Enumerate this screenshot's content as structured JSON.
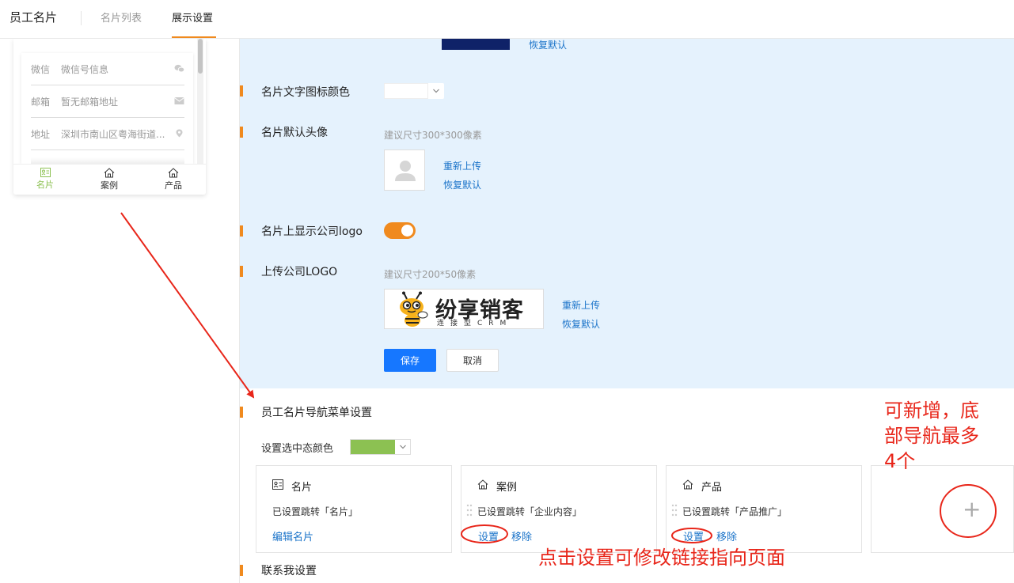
{
  "header": {
    "title": "员工名片",
    "tabs": [
      {
        "label": "名片列表",
        "active": false
      },
      {
        "label": "展示设置",
        "active": true
      }
    ]
  },
  "preview": {
    "rows": [
      {
        "key": "微信",
        "value": "微信号信息",
        "icon": "wechat-icon"
      },
      {
        "key": "邮箱",
        "value": "暂无邮箱地址",
        "icon": "mail-icon"
      },
      {
        "key": "地址",
        "value": "深圳市南山区粤海街道...",
        "icon": "location-pin-icon"
      }
    ],
    "bottom_nav": [
      {
        "label": "名片",
        "icon": "card-icon",
        "active": true
      },
      {
        "label": "案例",
        "icon": "home-icon",
        "active": false
      },
      {
        "label": "产品",
        "icon": "home-icon",
        "active": false
      }
    ]
  },
  "settings": {
    "top_reset": "恢复默认",
    "text_icon_color_label": "名片文字图标颜色",
    "default_avatar": {
      "label": "名片默认头像",
      "hint": "建议尺寸300*300像素",
      "reupload": "重新上传",
      "reset": "恢复默认"
    },
    "show_logo": {
      "label": "名片上显示公司logo",
      "on": true
    },
    "upload_logo": {
      "label": "上传公司LOGO",
      "hint": "建议尺寸200*50像素",
      "logo_text": "纷享销客",
      "logo_sub": "连接型CRM",
      "reupload": "重新上传",
      "reset": "恢复默认"
    },
    "save": "保存",
    "cancel": "取消"
  },
  "nav_menu": {
    "section_title": "员工名片导航菜单设置",
    "selected_color_label": "设置选中态颜色",
    "selected_color": "#8cc152",
    "accent": "#f08a1e",
    "cards": [
      {
        "title": "名片",
        "icon": "card-icon",
        "desc": "已设置跳转「名片」",
        "actions": [
          "编辑名片"
        ]
      },
      {
        "title": "案例",
        "icon": "home-icon",
        "desc": "已设置跳转「企业内容」",
        "actions": [
          "设置",
          "移除"
        ]
      },
      {
        "title": "产品",
        "icon": "home-icon",
        "desc": "已设置跳转「产品推广」",
        "actions": [
          "设置",
          "移除"
        ]
      }
    ],
    "add_symbol": "+"
  },
  "contact_section": {
    "title": "联系我设置"
  },
  "annotations": {
    "add_note_lines": [
      "可新增，底",
      "部导航最多",
      "4个"
    ],
    "settings_note": "点击设置可修改链接指向页面"
  }
}
